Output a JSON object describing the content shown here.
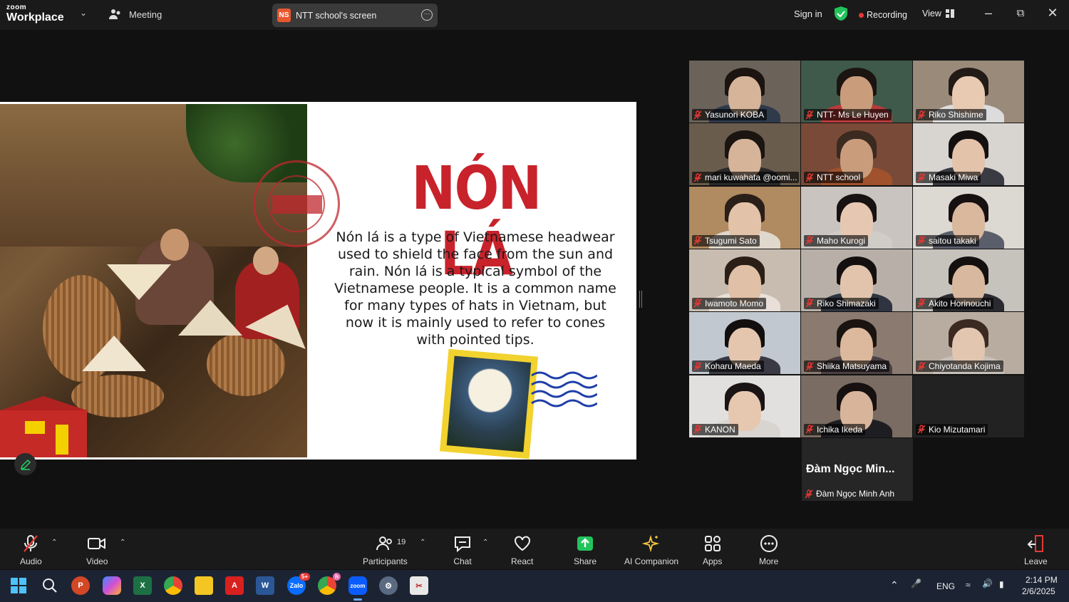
{
  "topbar": {
    "brand_small": "zoom",
    "brand_big": "Workplace",
    "meeting_label": "Meeting",
    "share_badge": "NS",
    "share_title": "NTT school's screen",
    "signin": "Sign in",
    "recording": "Recording",
    "view": "View"
  },
  "slide": {
    "title": "NÓN LÁ",
    "description": "Nón lá is a type of Vietnamese headwear used to shield the face from the sun and rain. Nón lá is a typical symbol of the Vietnamese people. It is a common name for many types of hats in Vietnam, but now it is mainly used to refer to cones with pointed tips."
  },
  "participants": [
    {
      "name": "Yasunori KOBA",
      "bg": "#6b625a",
      "skin": "#d6b49a",
      "hair": "#1b1410",
      "body": "#2f3a4a"
    },
    {
      "name": "NTT- Ms Le Huyen",
      "bg": "#3f5a4a",
      "skin": "#c99c7c",
      "hair": "#1b1410",
      "body": "#b73b3b"
    },
    {
      "name": "Riko Shishime",
      "bg": "#9a8a7a",
      "skin": "#e8c9b2",
      "hair": "#221a16",
      "body": "#dcdcdc"
    },
    {
      "name": "mari kuwahata @oomi...",
      "bg": "#6a5c4c",
      "skin": "#d6b49a",
      "hair": "#1b1410",
      "body": "#2a2a2a"
    },
    {
      "name": "NTT school",
      "bg": "#7a4a38",
      "skin": "#c99c7c",
      "hair": "#3a2a20",
      "body": "#a0522d"
    },
    {
      "name": "Masaki Miwa",
      "bg": "#d8d4d0",
      "skin": "#e3c3aa",
      "hair": "#151010",
      "body": "#3a3a42"
    },
    {
      "name": "Tsugumi Sato",
      "bg": "#b08a60",
      "skin": "#e2c2a8",
      "hair": "#2a1f18",
      "body": "#e0d8cc"
    },
    {
      "name": "Maho Kurogi",
      "bg": "#c9c4c0",
      "skin": "#e6c8b2",
      "hair": "#181212",
      "body": "#d0ccc8"
    },
    {
      "name": "saitou takaki",
      "bg": "#dcd8d2",
      "skin": "#d9b89e",
      "hair": "#161010",
      "body": "#5a5e6a"
    },
    {
      "name": "Iwamoto Momo",
      "bg": "#c8bcb0",
      "skin": "#e0c0a6",
      "hair": "#2a1e16",
      "body": "#e8e0d8"
    },
    {
      "name": "Riko Shimazaki",
      "bg": "#b8b0a8",
      "skin": "#e2c4ac",
      "hair": "#151010",
      "body": "#2e3440"
    },
    {
      "name": "Akito Horinouchi",
      "bg": "#c6c2bc",
      "skin": "#d8b89e",
      "hair": "#141010",
      "body": "#2a2a30"
    },
    {
      "name": "Koharu Maeda",
      "bg": "#c2c8d0",
      "skin": "#e4c6ae",
      "hair": "#120e0e",
      "body": "#3a3a44"
    },
    {
      "name": "Shiika Matsuyama",
      "bg": "#8a7a70",
      "skin": "#dcb89c",
      "hair": "#1a1410",
      "body": "#4a4044"
    },
    {
      "name": "Chiyotanda Kojima",
      "bg": "#b8aca0",
      "skin": "#e2c6b0",
      "hair": "#3a2a22",
      "body": "#c8c0b8"
    },
    {
      "name": "KANON",
      "bg": "#e2e0de",
      "skin": "#e6c8b0",
      "hair": "#1a1414",
      "body": "#d8d4d0"
    },
    {
      "name": "Ichika Ikeda",
      "bg": "#7a6c62",
      "skin": "#d8b49a",
      "hair": "#161010",
      "body": "#1e1e22"
    },
    {
      "name": "Kio Mizutamari",
      "bg": "#222222",
      "skin": "#222222",
      "hair": "#222222",
      "body": "#222222"
    }
  ],
  "name_tile": {
    "display": "Đàm Ngọc Min...",
    "label": "Đàm Ngọc Minh Anh"
  },
  "toolbar": {
    "audio": "Audio",
    "video": "Video",
    "participants": "Participants",
    "participant_count": "19",
    "chat": "Chat",
    "react": "React",
    "share": "Share",
    "ai_companion": "AI Companion",
    "apps": "Apps",
    "more": "More",
    "leave": "Leave"
  },
  "taskbar": {
    "lang": "ENG",
    "time": "2:14 PM",
    "date": "2/6/2025",
    "zalo_badge": "5+",
    "chrome_badge": "h"
  },
  "colors": {
    "accent_green": "#23d366",
    "title_red": "#c8222b",
    "share_green": "#23c35c"
  }
}
